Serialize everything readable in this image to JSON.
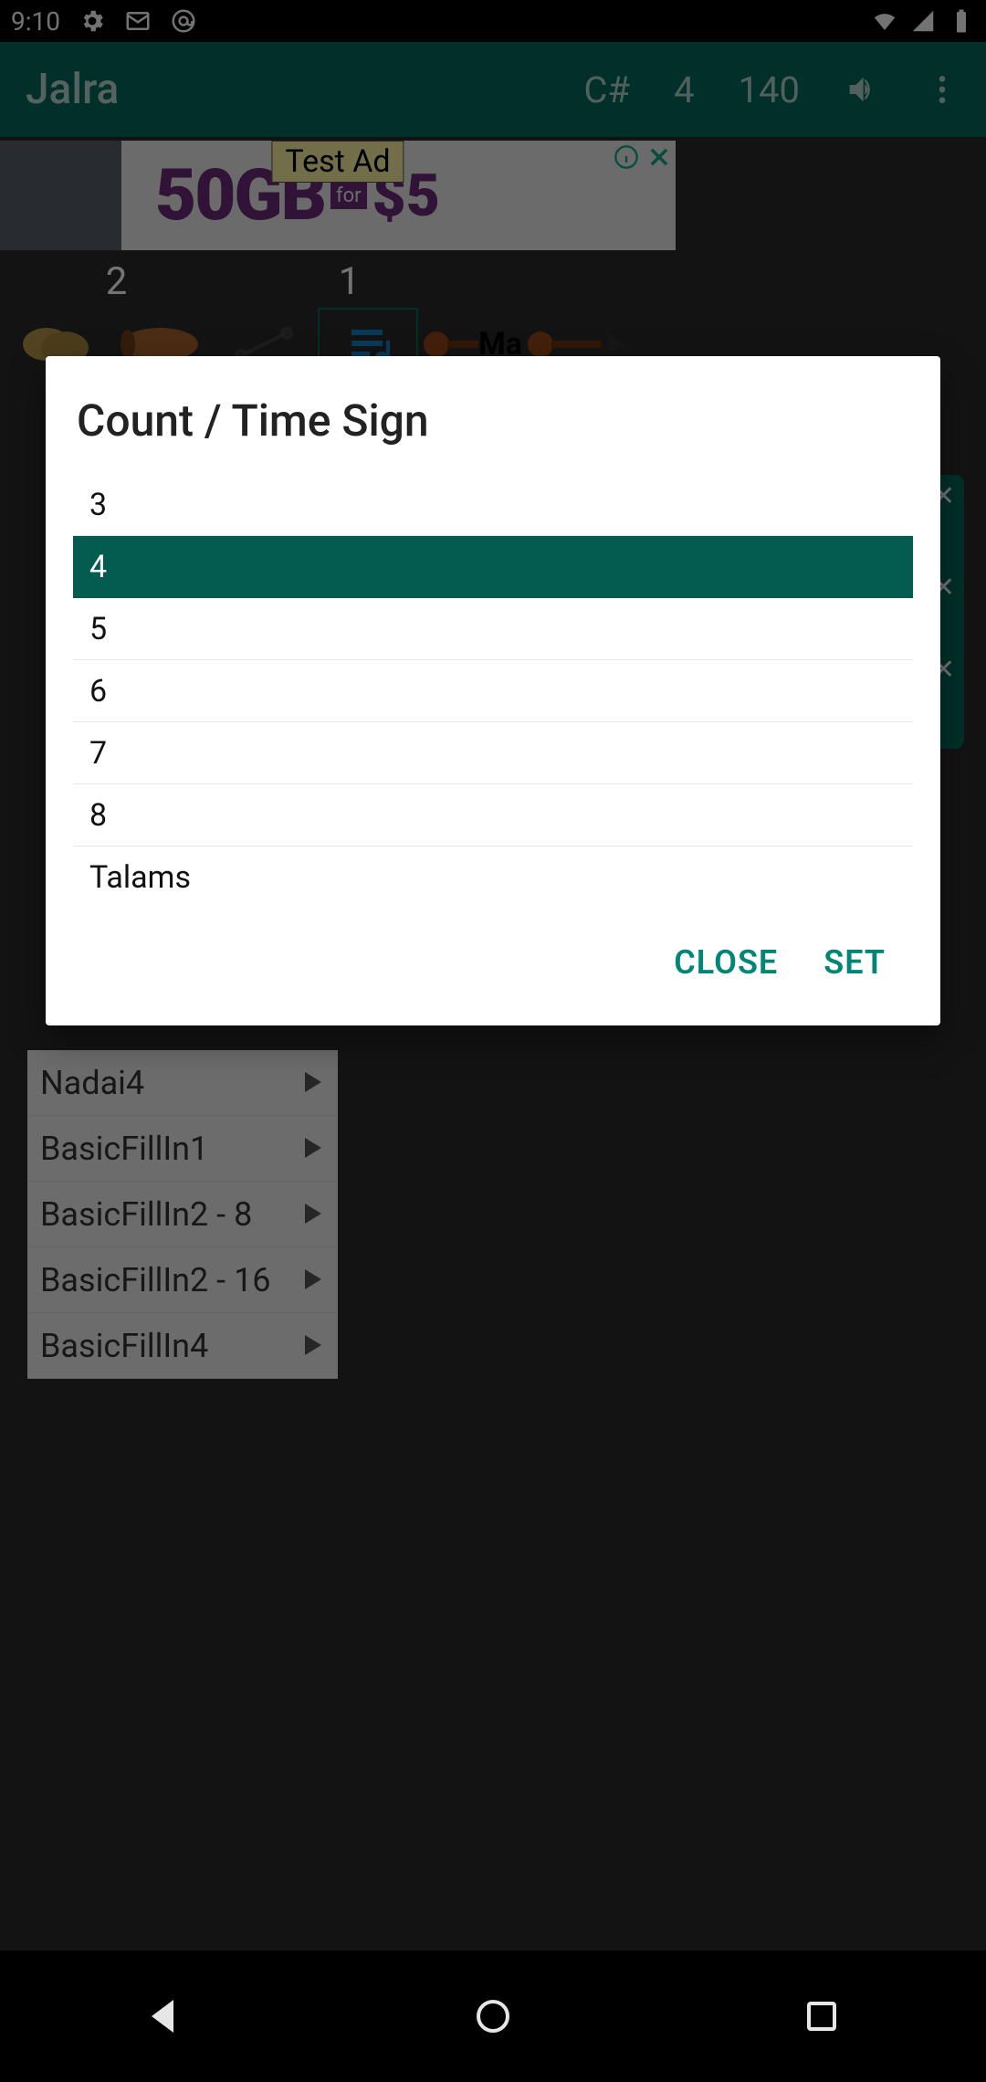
{
  "statusbar": {
    "time": "9:10"
  },
  "appbar": {
    "title": "Jalra",
    "key": "C#",
    "count": "4",
    "tempo": "140"
  },
  "ad": {
    "label": "Test Ad",
    "gb": "50GB",
    "for": "for",
    "price": "$5"
  },
  "counters": {
    "left": "2",
    "right": "1"
  },
  "instruments": {
    "label_ma": "Ma"
  },
  "patterns": [
    "Nadai4",
    "BasicFillIn1",
    "BasicFillIn2 - 8",
    "BasicFillIn2 - 16",
    "BasicFillIn4"
  ],
  "dialog": {
    "title": "Count / Time Sign",
    "options": [
      "3",
      "4",
      "5",
      "6",
      "7",
      "8",
      "Talams"
    ],
    "selected_index": 1,
    "close_label": "CLOSE",
    "set_label": "SET"
  }
}
